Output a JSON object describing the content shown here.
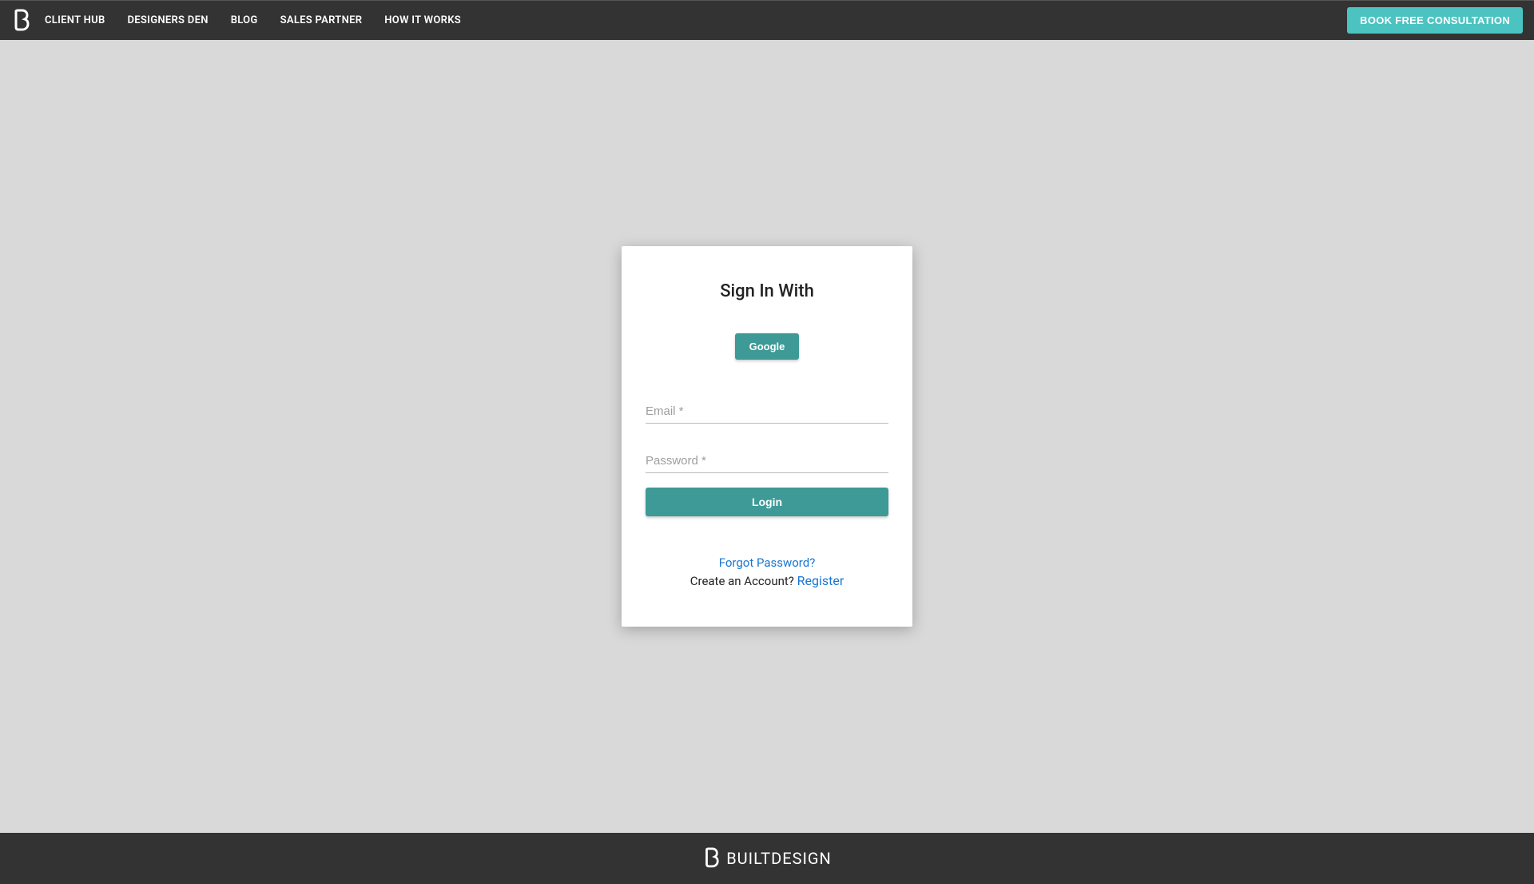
{
  "nav": {
    "items": [
      "CLIENT HUB",
      "DESIGNERS DEN",
      "BLOG",
      "SALES PARTNER",
      "HOW IT WORKS"
    ],
    "cta": "BOOK FREE CONSULTATION"
  },
  "login": {
    "title": "Sign In With",
    "google_label": "Google",
    "email_placeholder": "Email *",
    "password_placeholder": "Password *",
    "login_label": "Login",
    "forgot_label": "Forgot Password?",
    "create_text": "Create an Account? ",
    "register_label": "Register"
  },
  "footer": {
    "brand": "BUILTDESIGN"
  }
}
